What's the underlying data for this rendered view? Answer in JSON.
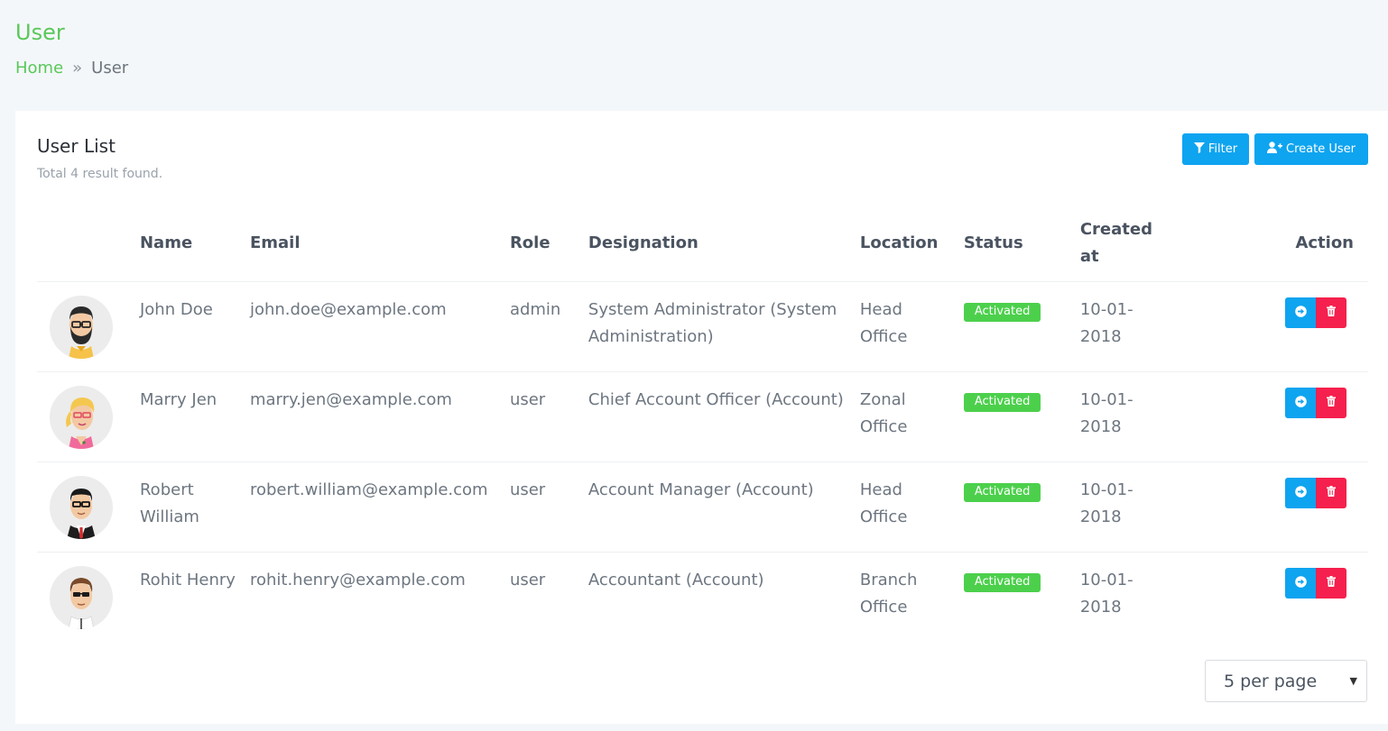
{
  "page": {
    "title": "User",
    "breadcrumb": {
      "home": "Home",
      "separator": "»",
      "current": "User"
    }
  },
  "card": {
    "title": "User List",
    "subtitle": "Total 4 result found.",
    "filter_label": "Filter",
    "create_label": "Create User"
  },
  "table": {
    "headers": {
      "name": "Name",
      "email": "Email",
      "role": "Role",
      "designation": "Designation",
      "location": "Location",
      "status": "Status",
      "created": "Created at",
      "action": "Action"
    },
    "rows": [
      {
        "name": "John Doe",
        "email": "john.doe@example.com",
        "role": "admin",
        "designation": "System Administrator (System Administration)",
        "location": "Head Office",
        "status": "Activated",
        "created": "10-01-2018",
        "avatar": "bearded-man"
      },
      {
        "name": "Marry Jen",
        "email": "marry.jen@example.com",
        "role": "user",
        "designation": "Chief Account Officer (Account)",
        "location": "Zonal Office",
        "status": "Activated",
        "created": "10-01-2018",
        "avatar": "blonde-woman"
      },
      {
        "name": "Robert William",
        "email": "robert.william@example.com",
        "role": "user",
        "designation": "Account Manager (Account)",
        "location": "Head Office",
        "status": "Activated",
        "created": "10-01-2018",
        "avatar": "man-in-suit"
      },
      {
        "name": "Rohit Henry",
        "email": "rohit.henry@example.com",
        "role": "user",
        "designation": "Accountant (Account)",
        "location": "Branch Office",
        "status": "Activated",
        "created": "10-01-2018",
        "avatar": "man-with-sunglasses"
      }
    ]
  },
  "pagination": {
    "per_page": "5 per page"
  },
  "colors": {
    "accent_green": "#5ac85a",
    "primary_blue": "#0ea4f0",
    "danger_red": "#f5204d",
    "badge_green": "#4cd04c"
  }
}
